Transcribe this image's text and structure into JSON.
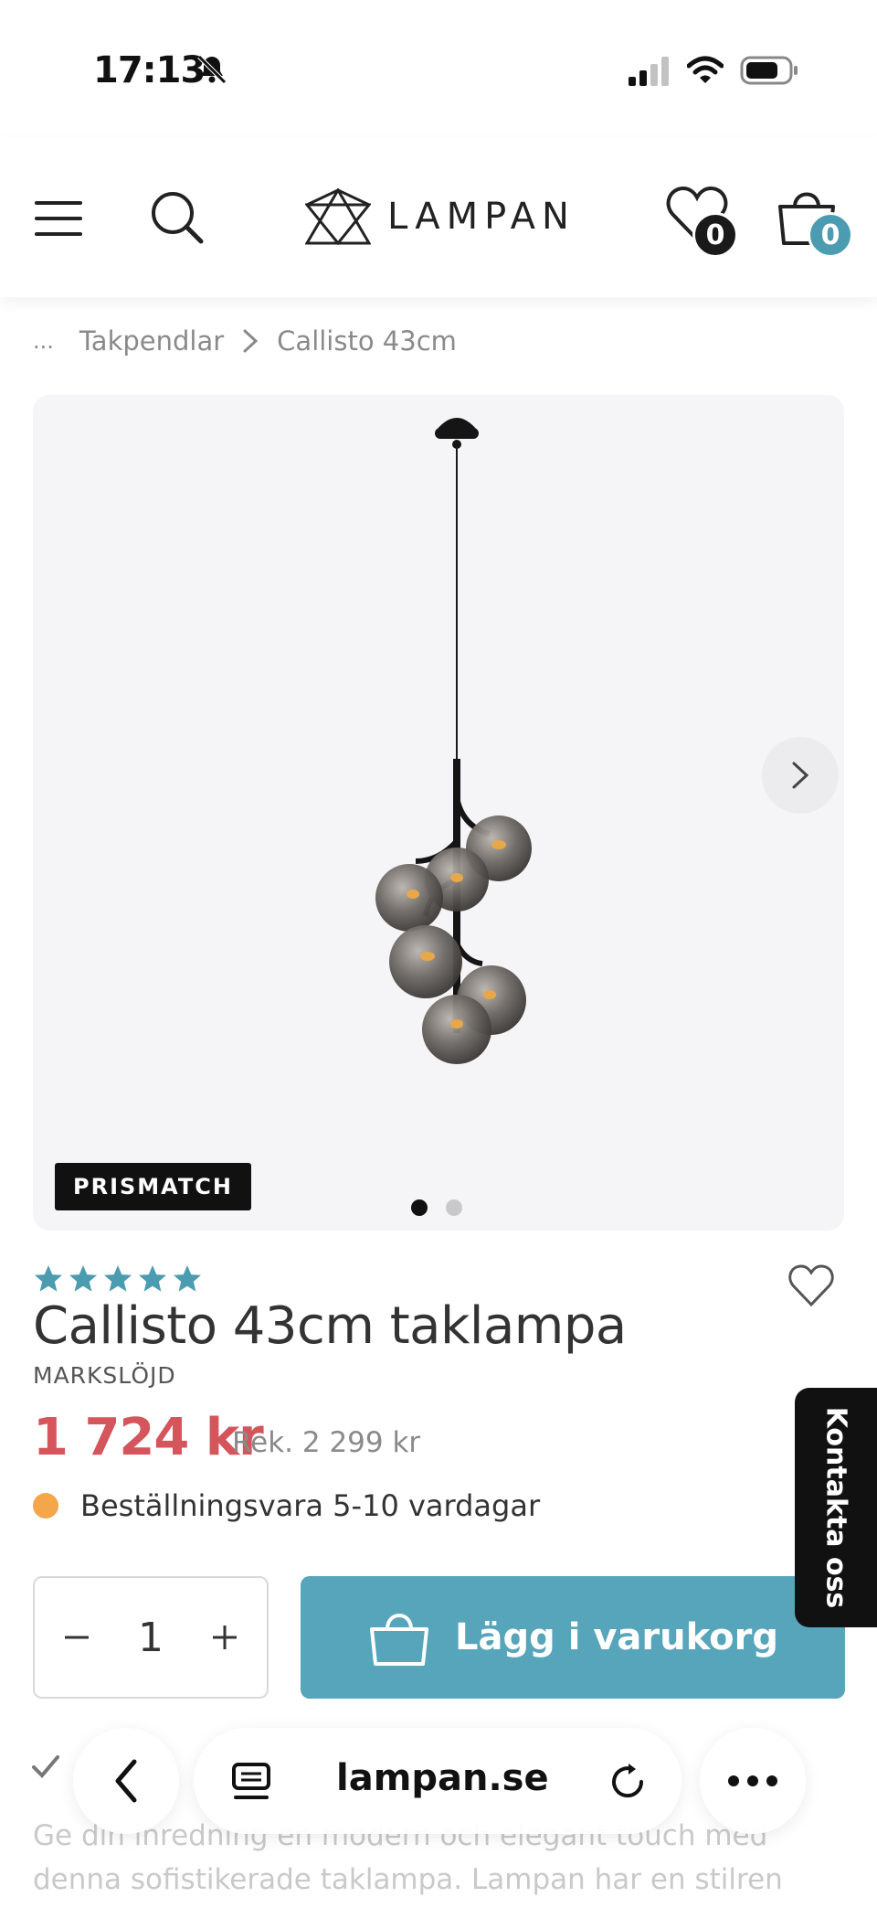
{
  "status_bar": {
    "time": "17:13"
  },
  "header": {
    "logo_text": "LAMPAN",
    "wishlist_count": "0",
    "cart_count": "0"
  },
  "breadcrumb": {
    "ellipsis": "...",
    "items": [
      "Takpendlar",
      "Callisto 43cm"
    ]
  },
  "gallery": {
    "badge": "PRISMATCH",
    "total_images": 2,
    "active_index": 0
  },
  "product": {
    "rating_stars": 5,
    "title": "Callisto 43cm taklampa",
    "brand": "MARKSLÖJD",
    "price": "1 724 kr",
    "rek_price": "Rek. 2 299 kr",
    "stock_status": "Beställningsvara 5-10 vardagar",
    "quantity": "1",
    "add_to_cart_label": "Lägg i varukorg"
  },
  "contact_tab": {
    "label": "Kontakta oss"
  },
  "description": {
    "text": "Ge din inredning en modern och elegant touch med denna sofistikerade taklampa. Lampan har en stilren"
  },
  "browser": {
    "url": "lampan.se"
  },
  "colors": {
    "accent_teal": "#57a5bb",
    "price_red": "#d4555c",
    "stock_orange": "#f4a64a",
    "star_teal": "#4b9cb0"
  }
}
